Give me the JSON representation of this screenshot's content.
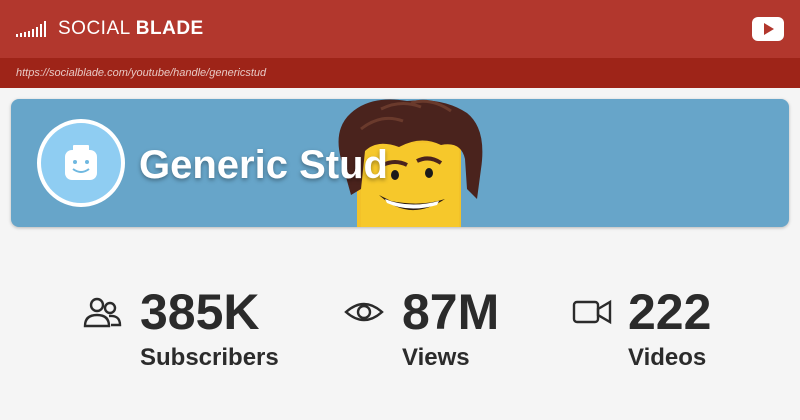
{
  "header": {
    "brand_light": "SOCIAL ",
    "brand_bold": "BLADE",
    "logo_icon": "signal-bars-icon",
    "youtube_icon": "youtube-icon",
    "url": "https://socialblade.com/youtube/handle/genericstud"
  },
  "channel": {
    "name": "Generic Stud",
    "avatar_icon": "lego-head-icon",
    "banner_color": "#67a5c9"
  },
  "stats": [
    {
      "value": "385K",
      "label": "Subscribers",
      "icon": "users-icon"
    },
    {
      "value": "87M",
      "label": "Views",
      "icon": "eye-icon"
    },
    {
      "value": "222",
      "label": "Videos",
      "icon": "video-camera-icon"
    }
  ],
  "colors": {
    "topbar": "#b2372d",
    "urlbar": "#9e2418",
    "text": "#2b2b2b"
  }
}
